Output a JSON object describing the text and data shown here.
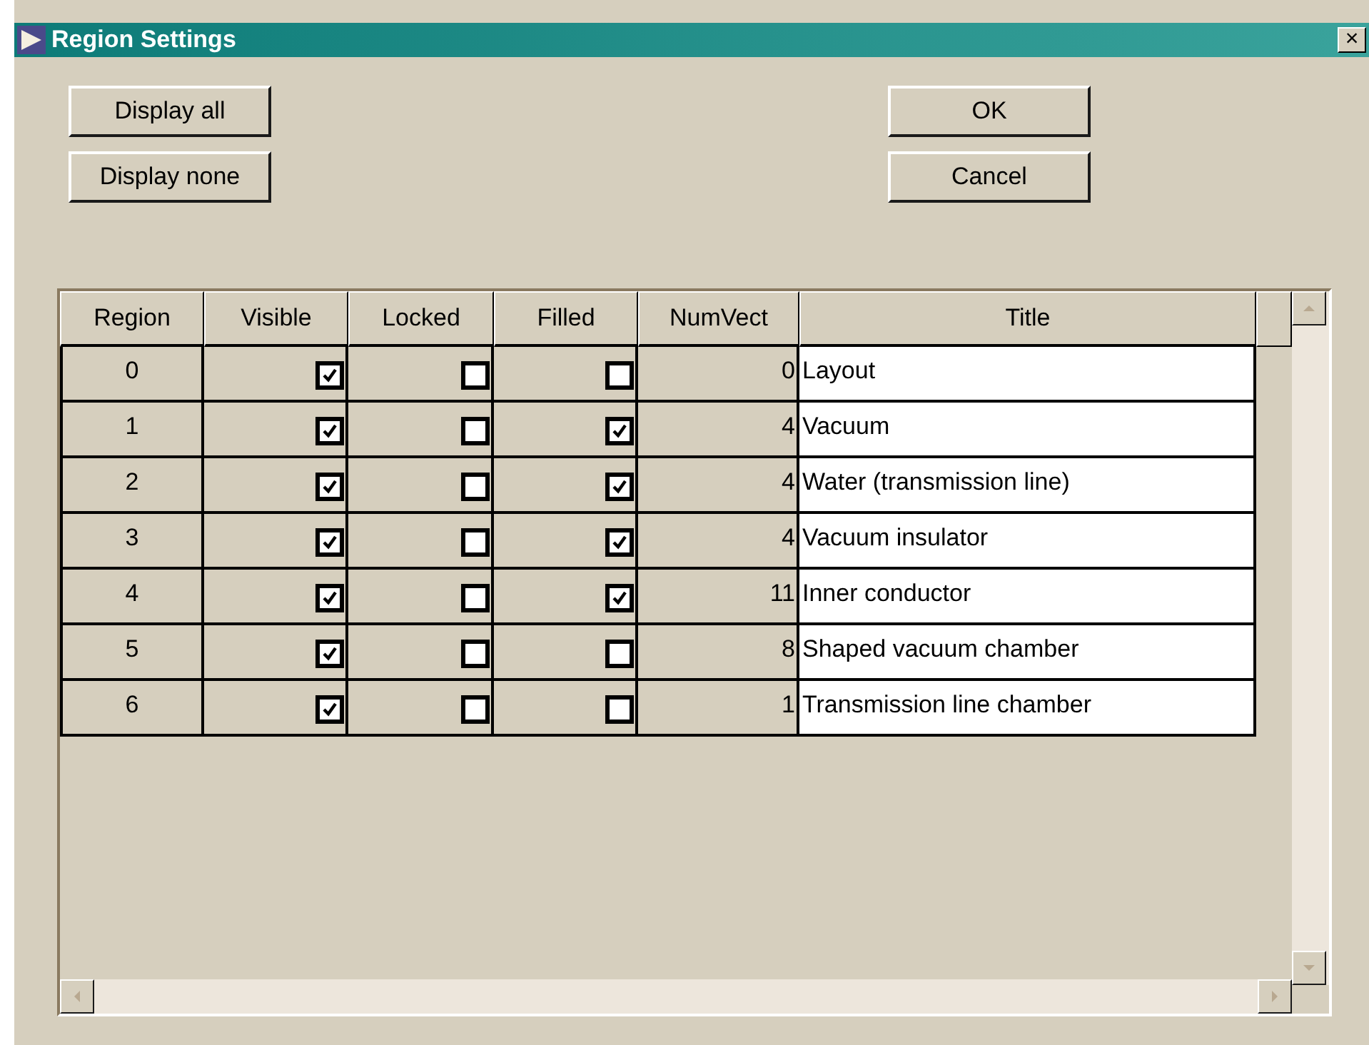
{
  "window": {
    "title": "Region Settings",
    "close": "×"
  },
  "buttons": [
    {
      "label": "Display all",
      "kind": "left"
    },
    {
      "label": "OK",
      "kind": "right"
    },
    {
      "label": "Display none",
      "kind": "left"
    },
    {
      "label": "Cancel",
      "kind": "right"
    }
  ],
  "table": {
    "columns": [
      "Region",
      "Visible",
      "Locked",
      "Filled",
      "NumVect",
      "Title"
    ],
    "rows": [
      {
        "region": "0",
        "visible": true,
        "locked": false,
        "filled": false,
        "numvect": "0",
        "title": "Layout"
      },
      {
        "region": "1",
        "visible": true,
        "locked": false,
        "filled": true,
        "numvect": "4",
        "title": "Vacuum"
      },
      {
        "region": "2",
        "visible": true,
        "locked": false,
        "filled": true,
        "numvect": "4",
        "title": "Water (transmission line)"
      },
      {
        "region": "3",
        "visible": true,
        "locked": false,
        "filled": true,
        "numvect": "4",
        "title": "Vacuum insulator"
      },
      {
        "region": "4",
        "visible": true,
        "locked": false,
        "filled": true,
        "numvect": "11",
        "title": "Inner conductor"
      },
      {
        "region": "5",
        "visible": true,
        "locked": false,
        "filled": false,
        "numvect": "8",
        "title": "Shaped vacuum chamber"
      },
      {
        "region": "6",
        "visible": true,
        "locked": false,
        "filled": false,
        "numvect": "1",
        "title": "Transmission line chamber"
      }
    ]
  }
}
